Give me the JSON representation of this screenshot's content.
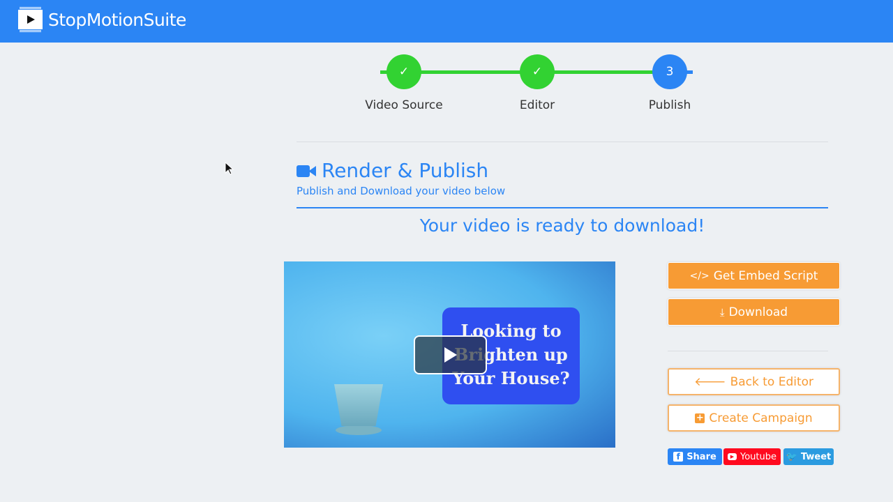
{
  "header": {
    "brand": "StopMotionSuite"
  },
  "steps": [
    {
      "label": "Video Source",
      "mark": "✓",
      "state": "done",
      "color": "#32d232"
    },
    {
      "label": "Editor",
      "mark": "✓",
      "state": "done",
      "color": "#32d232"
    },
    {
      "label": "Publish",
      "mark": "3",
      "state": "current",
      "color": "#2b85f4"
    }
  ],
  "section": {
    "title": "Render & Publish",
    "subtitle": "Publish and Download your video below",
    "icon": "video-camera-icon"
  },
  "ready_message": "Your video is ready to download!",
  "video": {
    "overlay_text": [
      "Looking to",
      "Brighten up",
      "Your House?"
    ]
  },
  "actions": {
    "embed": "Get Embed Script",
    "download": "Download",
    "back": "Back to Editor",
    "campaign": "Create Campaign"
  },
  "social": {
    "share": "Share",
    "youtube": "Youtube",
    "tweet": "Tweet"
  },
  "colors": {
    "brand": "#2b85f4",
    "accent": "#f79b34",
    "done": "#32d232",
    "facebook": "#2b85f4",
    "youtube": "#ff0a1f",
    "twitter": "#2b9be0"
  }
}
